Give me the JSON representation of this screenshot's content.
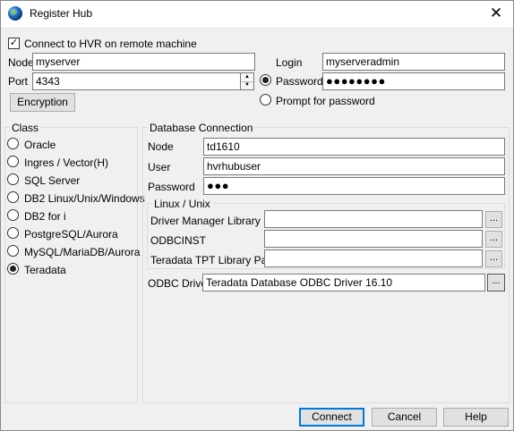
{
  "window": {
    "title": "Register Hub",
    "close_glyph": "✕"
  },
  "remote": {
    "checkbox_label": "Connect to HVR on remote machine",
    "checked": true,
    "node_label": "Node",
    "node_value": "myserver",
    "port_label": "Port",
    "port_value": "4343",
    "login_label": "Login",
    "login_value": "myserveradmin",
    "password_label": "Password",
    "password_value": "●●●●●●●●",
    "prompt_label": "Prompt for password",
    "encryption_button": "Encryption"
  },
  "class_group": {
    "title": "Class",
    "options": [
      {
        "label": "Oracle",
        "selected": false
      },
      {
        "label": "Ingres / Vector(H)",
        "selected": false
      },
      {
        "label": "SQL Server",
        "selected": false
      },
      {
        "label": "DB2 Linux/Unix/Windows",
        "selected": false
      },
      {
        "label": "DB2 for i",
        "selected": false
      },
      {
        "label": "PostgreSQL/Aurora",
        "selected": false
      },
      {
        "label": "MySQL/MariaDB/Aurora",
        "selected": false
      },
      {
        "label": "Teradata",
        "selected": true
      }
    ]
  },
  "db_connection": {
    "title": "Database Connection",
    "node_label": "Node",
    "node_value": "td1610",
    "user_label": "User",
    "user_value": "hvrhubuser",
    "password_label": "Password",
    "password_value": "●●●",
    "linux_group_title": "Linux / Unix",
    "driver_manager_label": "Driver Manager Library",
    "driver_manager_value": "",
    "odbcinst_label": "ODBCINST",
    "odbcinst_value": "",
    "tpt_label": "Teradata TPT Library Path",
    "tpt_value": "",
    "browse_glyph": "...",
    "odbc_driver_label": "ODBC Driver",
    "odbc_driver_value": "Teradata Database ODBC Driver 16.10"
  },
  "footer": {
    "connect": "Connect",
    "cancel": "Cancel",
    "help": "Help"
  },
  "colors": {
    "default_button_border": "#0078d7",
    "dialog_bg": "#f0f0f0"
  }
}
